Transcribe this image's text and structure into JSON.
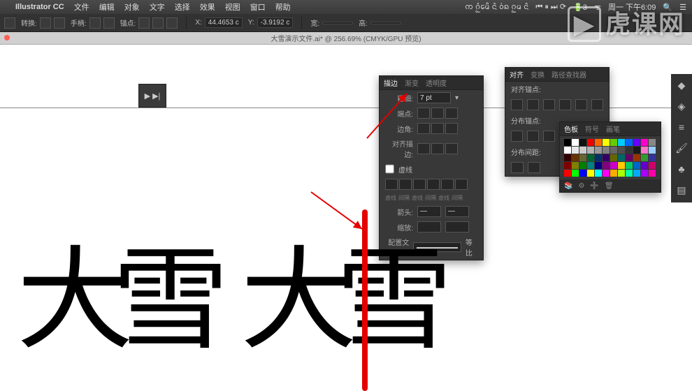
{
  "menubar": {
    "app": "Illustrator CC",
    "items": [
      "文件",
      "编辑",
      "对象",
      "文字",
      "选择",
      "效果",
      "视图",
      "窗口",
      "帮助"
    ],
    "right_text": "ᨠ ᨣᩴᩬᨾᩮᩥ ᨶᩫ ᩅ᩵ᨦ  ᨣᩬᨾ ᨶᩫ",
    "status_icons": "⏮ ⏸ ⏭ ⟳",
    "battery": "3",
    "clock": "周一 下午6:09"
  },
  "options": {
    "label_convert": "转换:",
    "label_handle": "手柄:",
    "label_anchor": "锚点:",
    "x_label": "X:",
    "x_value": "44.4653 c",
    "y_label": "Y:",
    "y_value": "-3.9192 c",
    "w_label": "宽:",
    "h_label": "高:"
  },
  "document": {
    "title": "大雪演示文件.ai* @ 256.69% (CMYK/GPU 预览)"
  },
  "stroke_panel": {
    "tabs": [
      "描边",
      "渐变",
      "透明度"
    ],
    "weight_label": "粗细:",
    "weight_value": "7 pt",
    "cap_label": "端点:",
    "corner_label": "边角:",
    "align_label": "对齐描边:",
    "dash_label": "虚线",
    "dash_headers": [
      "虚线",
      "间隔",
      "虚线",
      "间隔",
      "虚线",
      "间隔"
    ],
    "arrow_label": "箭头:",
    "scale_label": "缩放:",
    "profile_label": "配置文件:",
    "profile_value": "等比"
  },
  "align_panel": {
    "tabs": [
      "对齐",
      "变换",
      "路径查找器"
    ],
    "section1": "对齐锚点:",
    "section2": "分布锚点:",
    "section3": "分布间距:"
  },
  "swatch_panel": {
    "tabs": [
      "色板",
      "符号",
      "画笔"
    ],
    "colors_row1": [
      "#000",
      "#fff",
      "#111",
      "#e00",
      "#f60",
      "#ff0",
      "#6c0",
      "#0cf",
      "#06f",
      "#60f",
      "#f0c",
      "#888"
    ],
    "colors_row2": [
      "#fff",
      "#e6e6e6",
      "#ccc",
      "#b3b3b3",
      "#999",
      "#808080",
      "#666",
      "#4d4d4d",
      "#333",
      "#1a1a1a",
      "#f7c",
      "#9cf"
    ],
    "colors_row3": [
      "#300",
      "#630",
      "#663",
      "#063",
      "#036",
      "#306",
      "#660",
      "#066",
      "#606",
      "#930",
      "#393",
      "#339"
    ],
    "colors_row4": [
      "#800000",
      "#808000",
      "#008000",
      "#008080",
      "#000080",
      "#800080",
      "#c0c",
      "#fc0",
      "#0c6",
      "#06c",
      "#60c",
      "#c06"
    ],
    "colors_row5": [
      "#f00",
      "#0f0",
      "#00f",
      "#ff0",
      "#0ff",
      "#f0f",
      "#fa0",
      "#af0",
      "#0fa",
      "#0af",
      "#a0f",
      "#f0a"
    ]
  },
  "watermark": "虎课网",
  "glyph_text": "大雪",
  "float_panel_icons": "▶ ▶|"
}
